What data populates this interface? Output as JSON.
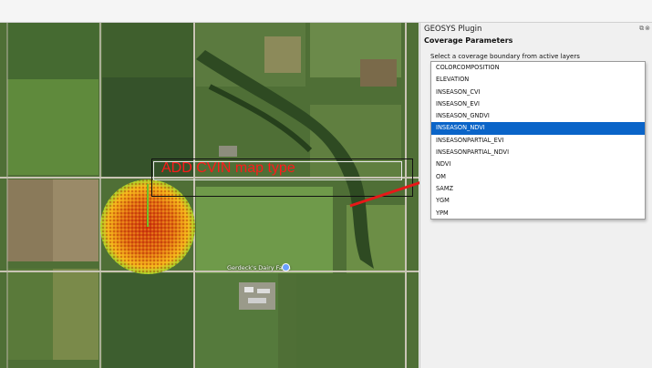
{
  "panel": {
    "title": "GEOSYS Plugin",
    "controls": "⧉⊗",
    "section_title": "Coverage Parameters",
    "select_label": "Select a coverage boundary from active layers"
  },
  "dropdown": {
    "items": [
      "COLORCOMPOSITION",
      "ELEVATION",
      "INSEASON_CVI",
      "INSEASON_EVI",
      "INSEASON_GNDVI",
      "INSEASON_NDVI",
      "INSEASONPARTIAL_EVI",
      "INSEASONPARTIAL_NDVI",
      "NDVI",
      "OM",
      "SAMZ",
      "YGM",
      "YPM"
    ],
    "selected_index": 5
  },
  "annotation": {
    "text": "ADD CVIN map type",
    "color": "#ff1a1a"
  },
  "map": {
    "place_label": "Gerdeck's Dairy Farm"
  }
}
